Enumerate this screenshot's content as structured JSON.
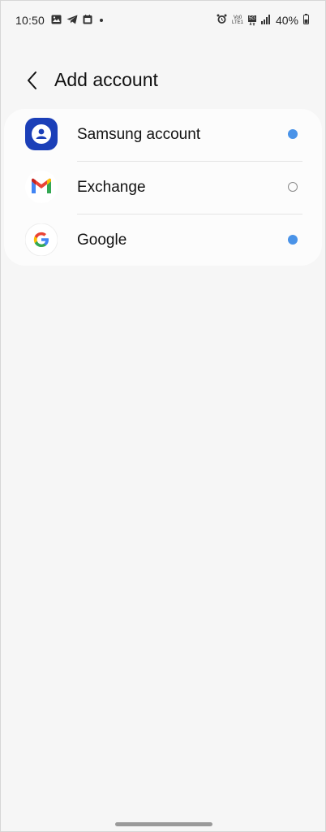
{
  "status_bar": {
    "time": "10:50",
    "volte_top": "Vo0",
    "volte_bottom": "LTE1",
    "network": "5G",
    "battery": "40%"
  },
  "header": {
    "title": "Add account"
  },
  "accounts": [
    {
      "label": "Samsung account",
      "icon": "samsung-account-icon",
      "status": "active"
    },
    {
      "label": "Exchange",
      "icon": "gmail-icon",
      "status": "inactive"
    },
    {
      "label": "Google",
      "icon": "google-icon",
      "status": "active"
    }
  ],
  "colors": {
    "background": "#f6f6f6",
    "card": "#fcfcfc",
    "active_dot": "#4a93e8",
    "samsung_blue": "#1b3fb8"
  }
}
